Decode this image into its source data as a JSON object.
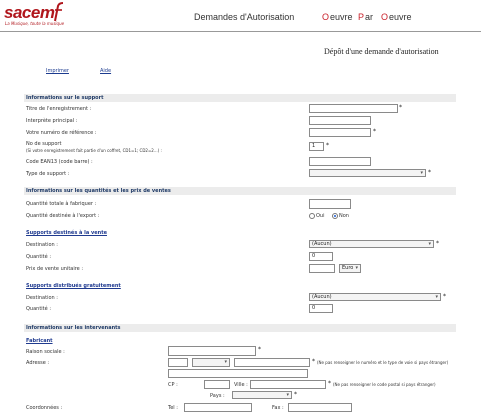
{
  "header": {
    "logo_text": "sacem",
    "logo_tagline": "La Musique, toute la musique",
    "nav": [
      "Demandes d'Autorisation",
      "Oeuvre",
      "Par",
      "Oeuvre"
    ]
  },
  "page_title": "Dépôt d'une demande d'autorisation",
  "links": {
    "print": "Imprimer",
    "help": "Aide"
  },
  "support": {
    "section_title": "Informations sur le support",
    "title_label": "Titre de l'enregistrement :",
    "artist_label": "Interprète principal :",
    "reference_label": "Votre numéro de référence :",
    "number_label": "No de support",
    "number_hint": "(Si votre enregistrement fait partie d'un coffret, CD1=1; CD2=2...) :",
    "number_value": "1",
    "ean_label": "Code EAN13 (code barre) :",
    "type_label": "Type de support :"
  },
  "quantities": {
    "section_title": "Informations sur les quantités et les prix de ventes",
    "total_label": "Quantité totale à fabriquer :",
    "export_label": "Quantité destinée à l'export :",
    "export_yes": "Oui",
    "export_no": "Non",
    "export_selected": "Non"
  },
  "sale": {
    "title": "Supports destinés à la vente",
    "destination_label": "Destination :",
    "destination_value": "(Aucun)",
    "quantity_label": "Quantité :",
    "quantity_value": "0",
    "price_label": "Prix de vente unitaire :",
    "currency_value": "Euro"
  },
  "free": {
    "title": "Supports distribués gratuitement",
    "destination_label": "Destination :",
    "destination_value": "(Aucun)",
    "quantity_label": "Quantité :",
    "quantity_value": "0"
  },
  "parties": {
    "section_title": "Informations sur les intervenants",
    "manufacturer_title": "Fabricant",
    "company_label": "Raison sociale :",
    "address_label": "Adresse :",
    "address_hint": "(Ne pas renseigner le numéro et le type de voie si pays étranger)",
    "postcode_label": "CP :",
    "city_label": "Ville :",
    "postcode_hint": "(Ne pas renseigner le code postal si pays étranger)",
    "country_label": "Pays :",
    "contact_label": "Coordonnées :",
    "tel_label": "Tel :",
    "fax_label": "Fax :"
  },
  "required_mark": "*",
  "colors": {
    "brand_red": "#b0161c",
    "section_blue": "#1f3a66",
    "link_blue": "#1c3b8f"
  }
}
